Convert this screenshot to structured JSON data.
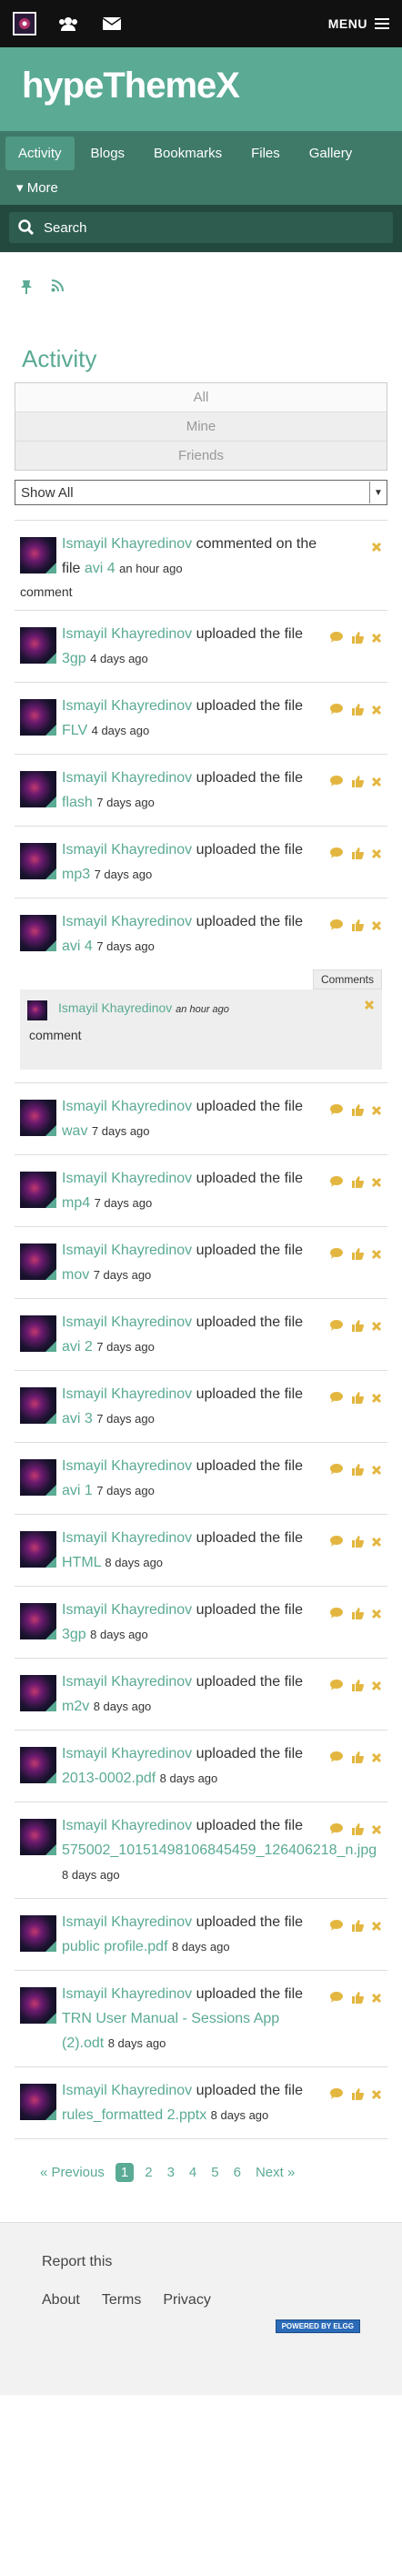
{
  "topbar": {
    "menu_label": "MENU"
  },
  "site": {
    "title": "hypeThemeX"
  },
  "nav": {
    "tabs": [
      {
        "label": "Activity"
      },
      {
        "label": "Blogs"
      },
      {
        "label": "Bookmarks"
      },
      {
        "label": "Files"
      },
      {
        "label": "Gallery"
      }
    ],
    "more_label": "▾ More"
  },
  "search": {
    "placeholder": "Search"
  },
  "page": {
    "title": "Activity",
    "filters": [
      "All",
      "Mine",
      "Friends"
    ],
    "select_value": "Show All"
  },
  "items": [
    {
      "user": "Ismayil Khayredinov",
      "action": "commented on the file",
      "file": "avi 4",
      "time": "an hour ago",
      "note": "comment",
      "kind": "comment"
    },
    {
      "user": "Ismayil Khayredinov",
      "action": "uploaded the file",
      "file": "3gp",
      "time": "4 days ago"
    },
    {
      "user": "Ismayil Khayredinov",
      "action": "uploaded the file",
      "file": "FLV",
      "time": "4 days ago"
    },
    {
      "user": "Ismayil Khayredinov",
      "action": "uploaded the file",
      "file": "flash",
      "time": "7 days ago"
    },
    {
      "user": "Ismayil Khayredinov",
      "action": "uploaded the file",
      "file": "mp3",
      "time": "7 days ago"
    },
    {
      "user": "Ismayil Khayredinov",
      "action": "uploaded the file",
      "file": "avi 4",
      "time": "7 days ago"
    },
    {
      "user": "Ismayil Khayredinov",
      "action": "uploaded the file",
      "file": "wav",
      "time": "7 days ago"
    },
    {
      "user": "Ismayil Khayredinov",
      "action": "uploaded the file",
      "file": "mp4",
      "time": "7 days ago"
    },
    {
      "user": "Ismayil Khayredinov",
      "action": "uploaded the file",
      "file": "mov",
      "time": "7 days ago"
    },
    {
      "user": "Ismayil Khayredinov",
      "action": "uploaded the file",
      "file": "avi 2",
      "time": "7 days ago"
    },
    {
      "user": "Ismayil Khayredinov",
      "action": "uploaded the file",
      "file": "avi 3",
      "time": "7 days ago"
    },
    {
      "user": "Ismayil Khayredinov",
      "action": "uploaded the file",
      "file": "avi 1",
      "time": "7 days ago"
    },
    {
      "user": "Ismayil Khayredinov",
      "action": "uploaded the file",
      "file": "HTML",
      "time": "8 days ago"
    },
    {
      "user": "Ismayil Khayredinov",
      "action": "uploaded the file",
      "file": "3gp",
      "time": "8 days ago"
    },
    {
      "user": "Ismayil Khayredinov",
      "action": "uploaded the file",
      "file": "m2v",
      "time": "8 days ago"
    },
    {
      "user": "Ismayil Khayredinov",
      "action": "uploaded the file",
      "file": "2013-0002.pdf",
      "time": "8 days ago"
    },
    {
      "user": "Ismayil Khayredinov",
      "action": "uploaded the file",
      "file": "575002_10151498106845459_126406218_n.jpg",
      "time": "8 days ago"
    },
    {
      "user": "Ismayil Khayredinov",
      "action": "uploaded the file",
      "file": "public profile.pdf",
      "time": "8 days ago"
    },
    {
      "user": "Ismayil Khayredinov",
      "action": "uploaded the file",
      "file": "TRN User Manual - Sessions App (2).odt",
      "time": "8 days ago"
    },
    {
      "user": "Ismayil Khayredinov",
      "action": "uploaded the file",
      "file": "rules_formatted 2.pptx",
      "time": "8 days ago"
    }
  ],
  "comments_block": {
    "label": "Comments",
    "user": "Ismayil Khayredinov",
    "time": "an hour ago",
    "body": "comment"
  },
  "pager": {
    "prev": "« Previous",
    "pages": [
      "1",
      "2",
      "3",
      "4",
      "5",
      "6"
    ],
    "next": "Next »"
  },
  "footer": {
    "report": "Report this",
    "links": [
      "About",
      "Terms",
      "Privacy"
    ],
    "powered": "POWERED BY ELGG"
  },
  "colors": {
    "accent": "#5aaa94",
    "nav": "#3f7a69",
    "action_icons": "#e3b640"
  }
}
